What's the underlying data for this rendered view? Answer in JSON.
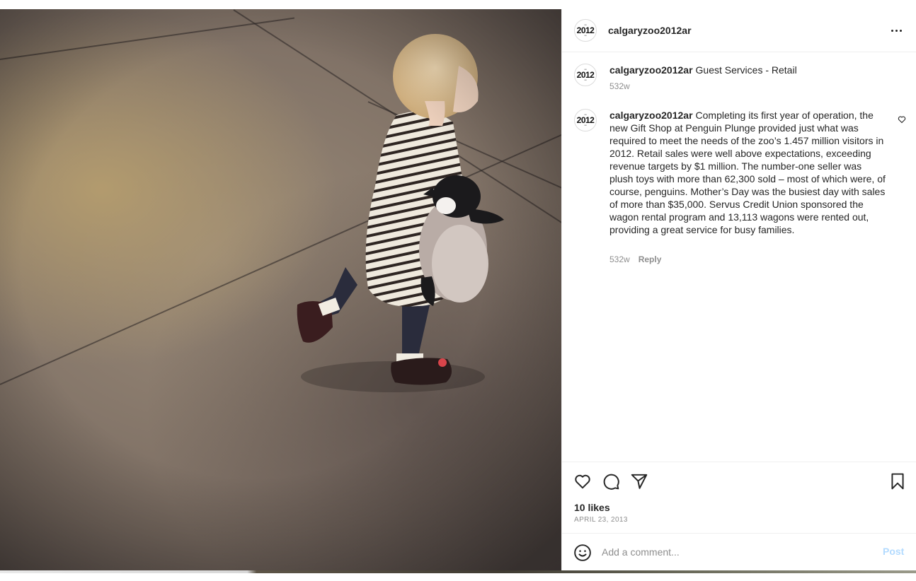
{
  "post": {
    "username": "calgaryzoo2012ar",
    "avatar_text": "2012",
    "image_alt": "Toddler in a striped dress walking while hugging a plush penguin"
  },
  "comments": [
    {
      "username": "calgaryzoo2012ar",
      "text": "Guest Services - Retail",
      "age": "532w"
    },
    {
      "username": "calgaryzoo2012ar",
      "text": "Completing its first year of operation, the new Gift Shop at Penguin Plunge provided just what was required to meet the needs of the zoo’s 1.457 million visitors in 2012. Retail sales were well above expectations, exceeding revenue targets by $1 million. The number-one seller was plush toys with more than 62,300 sold – most of which were, of course, penguins. Mother’s Day was the busiest day with sales of more than $35,000. Servus Credit Union sponsored the wagon rental program and 13,113 wagons were rented out, providing a great service for busy families.",
      "age": "532w",
      "reply_label": "Reply"
    }
  ],
  "actions": {
    "likes": "10 likes",
    "date": "APRIL 23, 2013"
  },
  "comment_box": {
    "placeholder": "Add a comment...",
    "post_label": "Post"
  },
  "icons": {
    "more": "more-options-icon",
    "like": "heart-icon",
    "comment": "comment-bubble-icon",
    "share": "paper-plane-icon",
    "save": "bookmark-icon",
    "emoji": "smiley-icon"
  },
  "colors": {
    "text": "#262626",
    "secondary": "#8e8e8e",
    "border": "#efefef",
    "post_disabled": "#b3dbff"
  }
}
